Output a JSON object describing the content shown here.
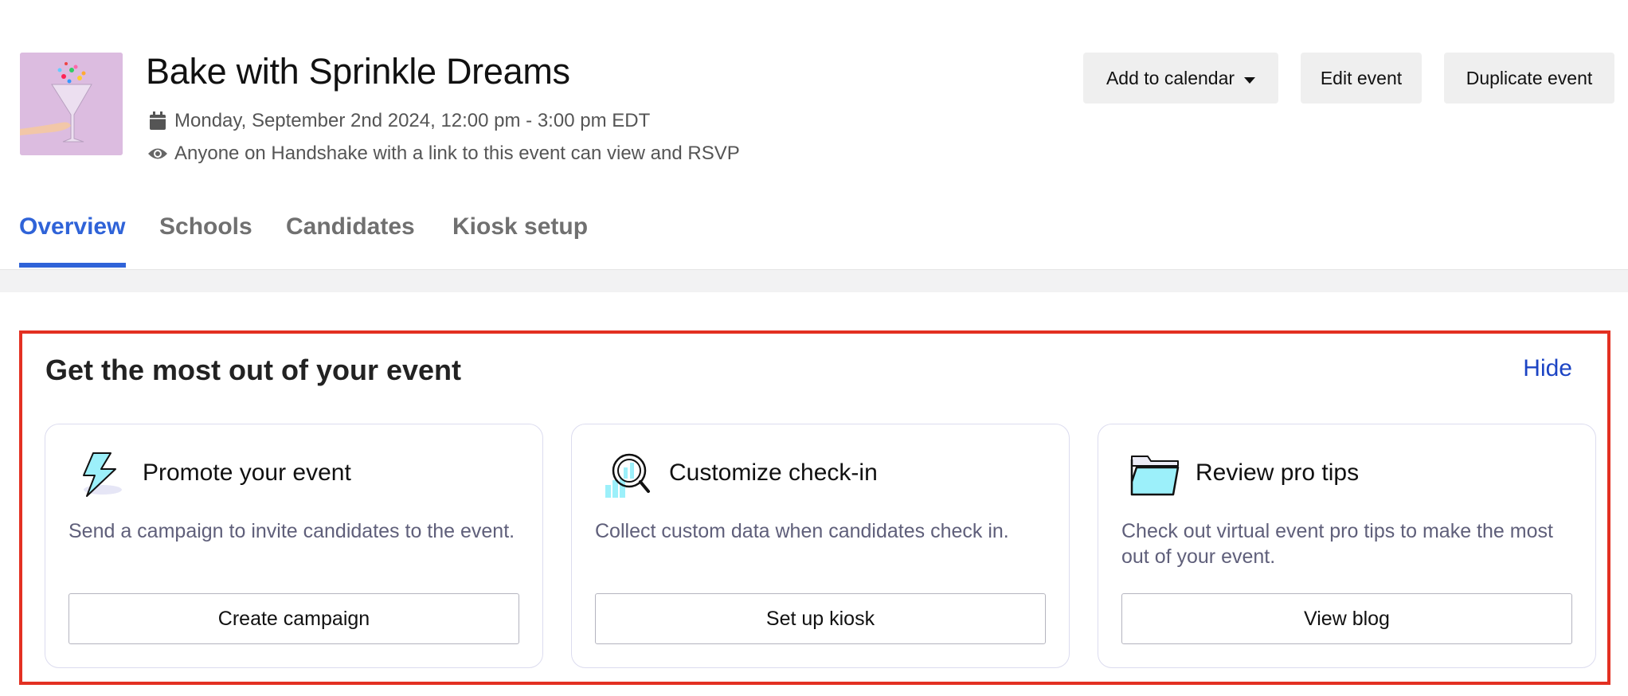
{
  "event": {
    "title": "Bake with Sprinkle Dreams",
    "date_time": "Monday, September 2nd 2024, 12:00 pm - 3:00 pm EDT",
    "visibility": "Anyone on Handshake with a link to this event can view and RSVP",
    "thumbnail_icon": "cocktail-glass-sprinkles-image"
  },
  "header_actions": {
    "add_to_calendar": "Add to calendar",
    "edit_event": "Edit event",
    "duplicate_event": "Duplicate event"
  },
  "tabs": [
    {
      "label": "Overview",
      "active": true
    },
    {
      "label": "Schools",
      "active": false
    },
    {
      "label": "Candidates",
      "active": false
    },
    {
      "label": "Kiosk setup",
      "active": false
    }
  ],
  "panel": {
    "title": "Get the most out of your event",
    "hide_label": "Hide",
    "cards": [
      {
        "icon": "lightning-bolt-icon",
        "title": "Promote your event",
        "description": "Send a campaign to invite candidates to the event.",
        "button": "Create campaign"
      },
      {
        "icon": "magnifier-chart-icon",
        "title": "Customize check-in",
        "description": "Collect custom data when candidates check in.",
        "button": "Set up kiosk"
      },
      {
        "icon": "folder-icon",
        "title": "Review pro tips",
        "description": "Check out virtual event pro tips to make the most out of your event.",
        "button": "View blog"
      }
    ]
  },
  "colors": {
    "accent": "#2f63d8",
    "link": "#1c44c4",
    "highlight_border": "#e33022",
    "icon_fill": "#9cf0fa"
  }
}
